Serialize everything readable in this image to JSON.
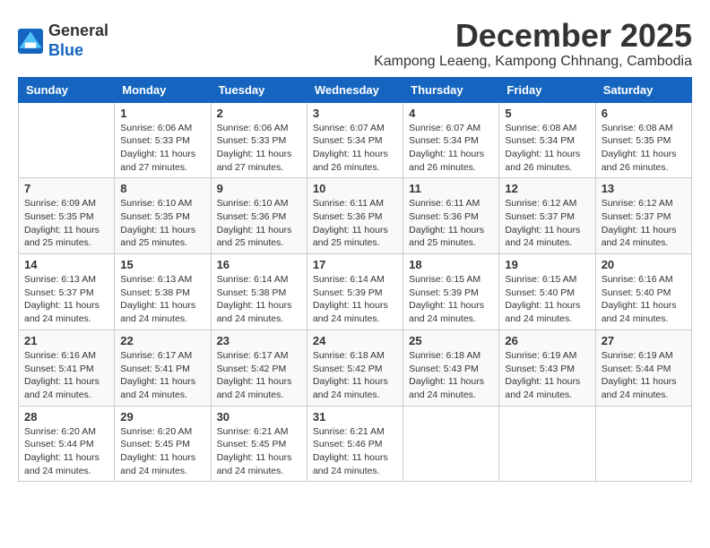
{
  "header": {
    "logo_general": "General",
    "logo_blue": "Blue",
    "month_title": "December 2025",
    "subtitle": "Kampong Leaeng, Kampong Chhnang, Cambodia"
  },
  "days_of_week": [
    "Sunday",
    "Monday",
    "Tuesday",
    "Wednesday",
    "Thursday",
    "Friday",
    "Saturday"
  ],
  "weeks": [
    [
      {
        "day": "",
        "content": ""
      },
      {
        "day": "1",
        "content": "Sunrise: 6:06 AM\nSunset: 5:33 PM\nDaylight: 11 hours\nand 27 minutes."
      },
      {
        "day": "2",
        "content": "Sunrise: 6:06 AM\nSunset: 5:33 PM\nDaylight: 11 hours\nand 27 minutes."
      },
      {
        "day": "3",
        "content": "Sunrise: 6:07 AM\nSunset: 5:34 PM\nDaylight: 11 hours\nand 26 minutes."
      },
      {
        "day": "4",
        "content": "Sunrise: 6:07 AM\nSunset: 5:34 PM\nDaylight: 11 hours\nand 26 minutes."
      },
      {
        "day": "5",
        "content": "Sunrise: 6:08 AM\nSunset: 5:34 PM\nDaylight: 11 hours\nand 26 minutes."
      },
      {
        "day": "6",
        "content": "Sunrise: 6:08 AM\nSunset: 5:35 PM\nDaylight: 11 hours\nand 26 minutes."
      }
    ],
    [
      {
        "day": "7",
        "content": "Sunrise: 6:09 AM\nSunset: 5:35 PM\nDaylight: 11 hours\nand 25 minutes."
      },
      {
        "day": "8",
        "content": "Sunrise: 6:10 AM\nSunset: 5:35 PM\nDaylight: 11 hours\nand 25 minutes."
      },
      {
        "day": "9",
        "content": "Sunrise: 6:10 AM\nSunset: 5:36 PM\nDaylight: 11 hours\nand 25 minutes."
      },
      {
        "day": "10",
        "content": "Sunrise: 6:11 AM\nSunset: 5:36 PM\nDaylight: 11 hours\nand 25 minutes."
      },
      {
        "day": "11",
        "content": "Sunrise: 6:11 AM\nSunset: 5:36 PM\nDaylight: 11 hours\nand 25 minutes."
      },
      {
        "day": "12",
        "content": "Sunrise: 6:12 AM\nSunset: 5:37 PM\nDaylight: 11 hours\nand 24 minutes."
      },
      {
        "day": "13",
        "content": "Sunrise: 6:12 AM\nSunset: 5:37 PM\nDaylight: 11 hours\nand 24 minutes."
      }
    ],
    [
      {
        "day": "14",
        "content": "Sunrise: 6:13 AM\nSunset: 5:37 PM\nDaylight: 11 hours\nand 24 minutes."
      },
      {
        "day": "15",
        "content": "Sunrise: 6:13 AM\nSunset: 5:38 PM\nDaylight: 11 hours\nand 24 minutes."
      },
      {
        "day": "16",
        "content": "Sunrise: 6:14 AM\nSunset: 5:38 PM\nDaylight: 11 hours\nand 24 minutes."
      },
      {
        "day": "17",
        "content": "Sunrise: 6:14 AM\nSunset: 5:39 PM\nDaylight: 11 hours\nand 24 minutes."
      },
      {
        "day": "18",
        "content": "Sunrise: 6:15 AM\nSunset: 5:39 PM\nDaylight: 11 hours\nand 24 minutes."
      },
      {
        "day": "19",
        "content": "Sunrise: 6:15 AM\nSunset: 5:40 PM\nDaylight: 11 hours\nand 24 minutes."
      },
      {
        "day": "20",
        "content": "Sunrise: 6:16 AM\nSunset: 5:40 PM\nDaylight: 11 hours\nand 24 minutes."
      }
    ],
    [
      {
        "day": "21",
        "content": "Sunrise: 6:16 AM\nSunset: 5:41 PM\nDaylight: 11 hours\nand 24 minutes."
      },
      {
        "day": "22",
        "content": "Sunrise: 6:17 AM\nSunset: 5:41 PM\nDaylight: 11 hours\nand 24 minutes."
      },
      {
        "day": "23",
        "content": "Sunrise: 6:17 AM\nSunset: 5:42 PM\nDaylight: 11 hours\nand 24 minutes."
      },
      {
        "day": "24",
        "content": "Sunrise: 6:18 AM\nSunset: 5:42 PM\nDaylight: 11 hours\nand 24 minutes."
      },
      {
        "day": "25",
        "content": "Sunrise: 6:18 AM\nSunset: 5:43 PM\nDaylight: 11 hours\nand 24 minutes."
      },
      {
        "day": "26",
        "content": "Sunrise: 6:19 AM\nSunset: 5:43 PM\nDaylight: 11 hours\nand 24 minutes."
      },
      {
        "day": "27",
        "content": "Sunrise: 6:19 AM\nSunset: 5:44 PM\nDaylight: 11 hours\nand 24 minutes."
      }
    ],
    [
      {
        "day": "28",
        "content": "Sunrise: 6:20 AM\nSunset: 5:44 PM\nDaylight: 11 hours\nand 24 minutes."
      },
      {
        "day": "29",
        "content": "Sunrise: 6:20 AM\nSunset: 5:45 PM\nDaylight: 11 hours\nand 24 minutes."
      },
      {
        "day": "30",
        "content": "Sunrise: 6:21 AM\nSunset: 5:45 PM\nDaylight: 11 hours\nand 24 minutes."
      },
      {
        "day": "31",
        "content": "Sunrise: 6:21 AM\nSunset: 5:46 PM\nDaylight: 11 hours\nand 24 minutes."
      },
      {
        "day": "",
        "content": ""
      },
      {
        "day": "",
        "content": ""
      },
      {
        "day": "",
        "content": ""
      }
    ]
  ]
}
